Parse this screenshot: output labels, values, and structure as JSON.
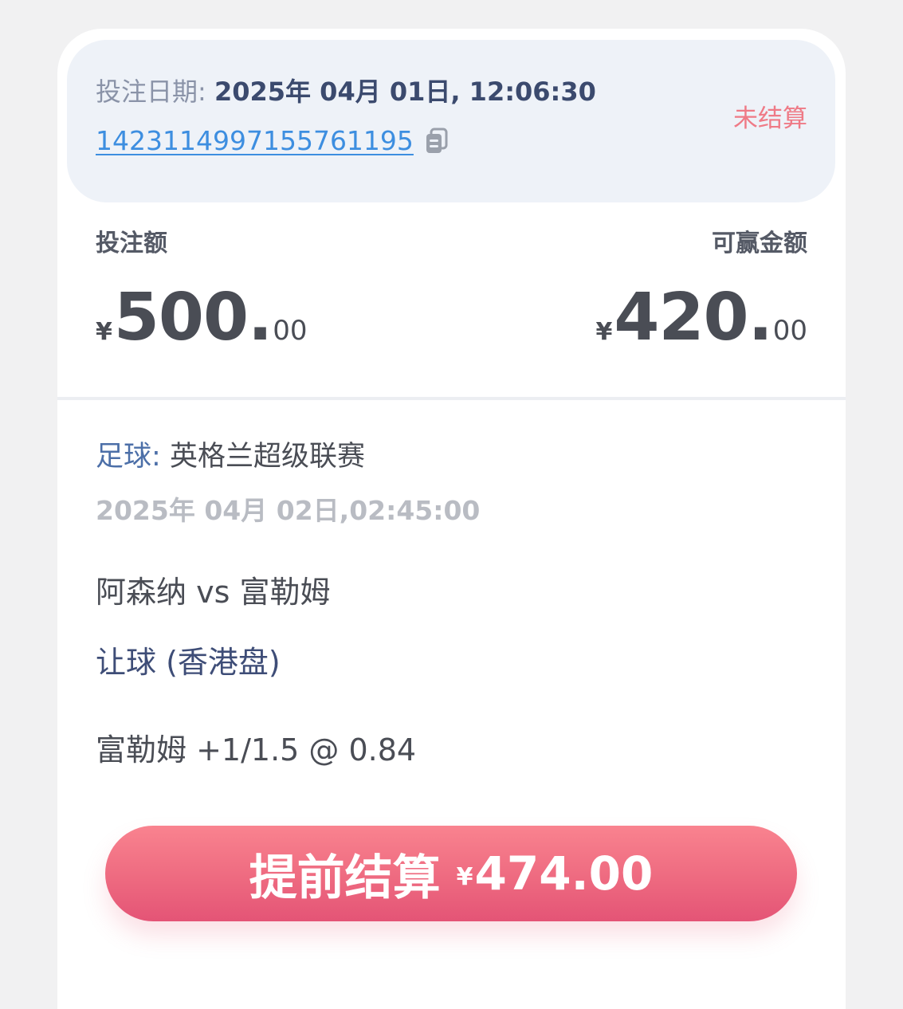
{
  "header": {
    "date_label": "投注日期:",
    "date_value": "2025年 04月 01日, 12:06:30",
    "ticket_id": "1423114997155761195",
    "copy_icon": "copy-icon",
    "status": "未结算",
    "status_color": "#ef7a86"
  },
  "stake": {
    "label": "投注额",
    "currency": "¥",
    "integer": "500",
    "dot": ".",
    "decimal": "00"
  },
  "payout": {
    "label": "可赢金额",
    "currency": "¥",
    "integer": "420",
    "dot": ".",
    "decimal": "00"
  },
  "event": {
    "sport": "足球:",
    "league": "英格兰超级联赛",
    "match_time": "2025年 04月 02日,02:45:00",
    "teams": "阿森纳 vs 富勒姆",
    "market": "让球 (香港盘)",
    "selection": "富勒姆 +1/1.5 @ 0.84"
  },
  "cashout": {
    "label": "提前结算",
    "currency": "¥",
    "amount": "474.00",
    "gradient_top": "#f9838f",
    "gradient_bottom": "#e45476"
  }
}
